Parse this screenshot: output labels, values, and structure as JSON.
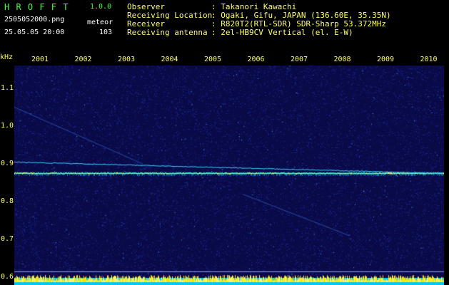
{
  "header": {
    "app_title": "H R O F F T",
    "version": "1.0.0",
    "filename": "2505052000.png",
    "mode": "meteor",
    "datetime": "25.05.05 20:00",
    "count": "103"
  },
  "info": {
    "labels": [
      "Observer",
      "Receiving Location",
      "Receiver",
      "Receiving antenna"
    ],
    "values": [
      ": Takanori Kawachi",
      ": Ogaki, Gifu, JAPAN (136.60E, 35.35N)",
      ": R820T2(RTL-SDR) SDR-Sharp 53.372MHz",
      ": 2el-HB9CV Vertical (el. E-W)"
    ]
  },
  "spectrogram": {
    "unit": "kHz",
    "time_labels": [
      "2001",
      "2002",
      "2003",
      "2004",
      "2005",
      "2006",
      "2007",
      "2008",
      "2009",
      "2010"
    ],
    "freq_labels": [
      "1.1",
      "1.0",
      "0.9",
      "0.8",
      "0.7",
      "0.6"
    ],
    "freq_ticks": [
      1.1,
      1.0,
      0.9,
      0.8,
      0.7,
      0.6
    ],
    "freq_range": [
      0.58,
      1.16
    ],
    "carrier_freq": 0.875,
    "colors": {
      "background": "#0a0a48",
      "noise": "#2a3cc8",
      "signal": "#44ffcc",
      "hot": "#ffff44",
      "bottom_bar": "#00c8ff"
    }
  }
}
